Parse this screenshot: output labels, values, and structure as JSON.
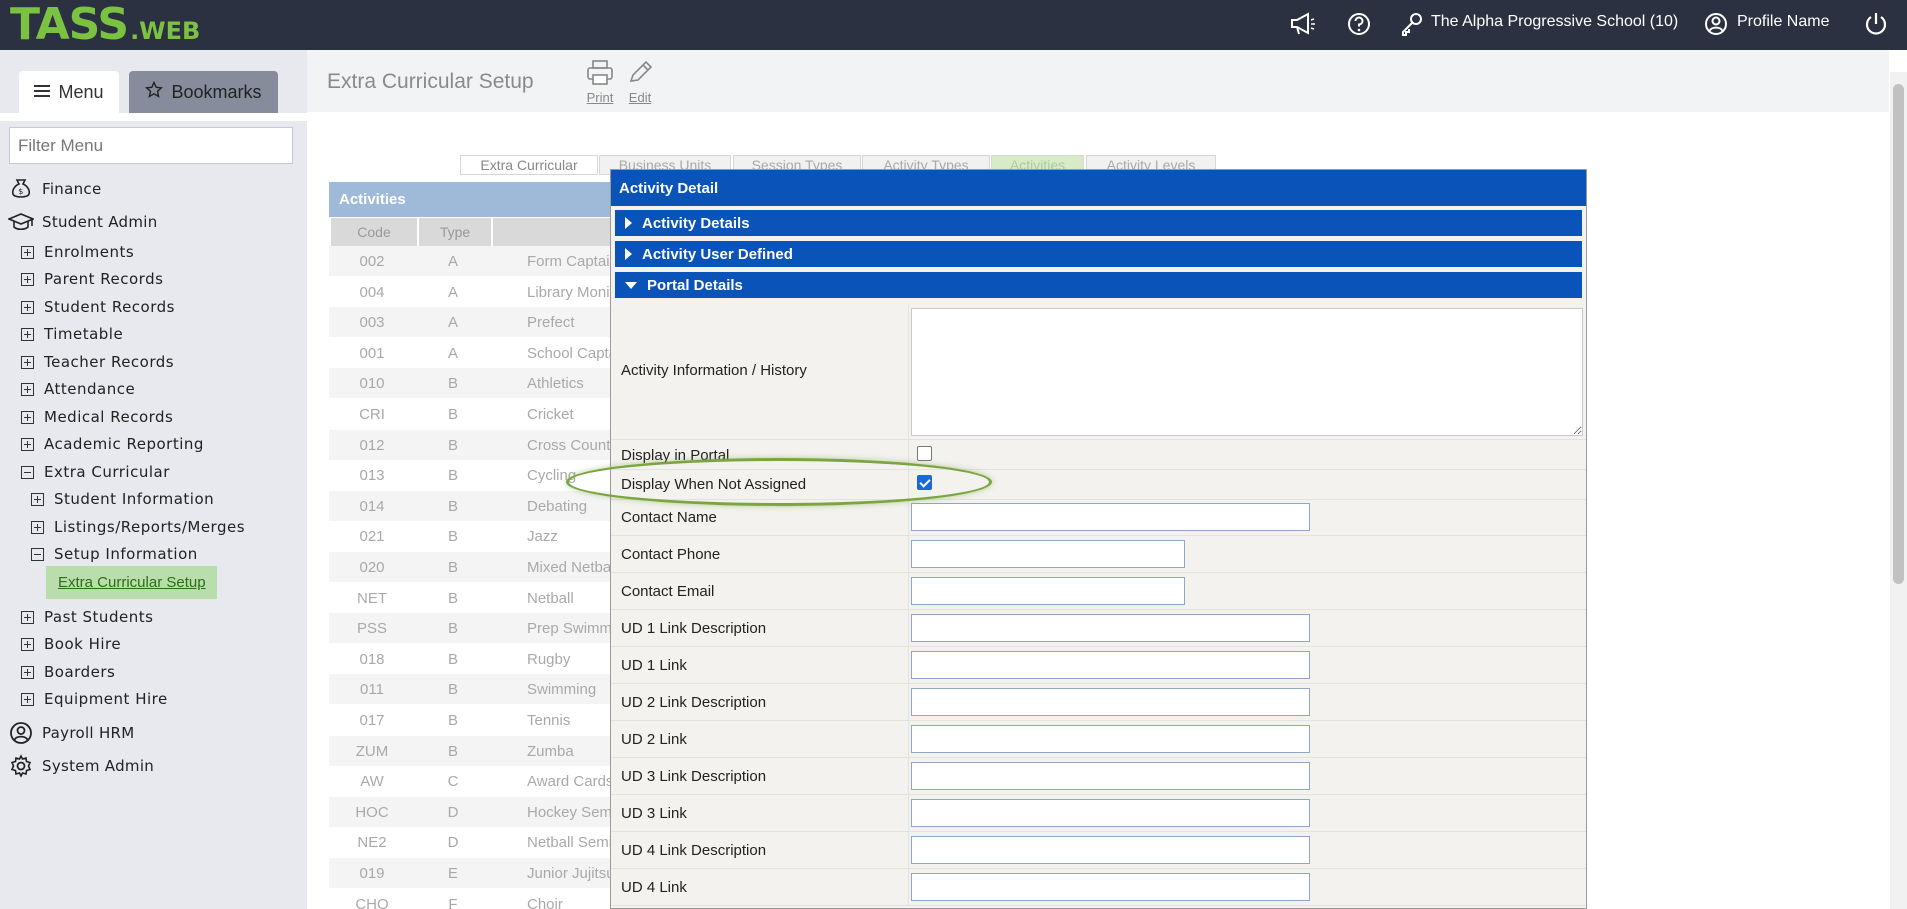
{
  "topbar": {
    "logo_main": "TASS",
    "logo_suffix": ".WEB",
    "school": "The Alpha Progressive School (10)",
    "profile": "Profile Name",
    "icons": [
      "megaphone-icon",
      "help-icon",
      "key-icon",
      "user-circle-icon",
      "power-icon"
    ]
  },
  "sidebar": {
    "menu_label": "Menu",
    "bookmarks_label": "Bookmarks",
    "filter_placeholder": "Filter Menu",
    "sections": {
      "finance": "Finance",
      "student_admin": "Student Admin",
      "payroll": "Payroll HRM",
      "system_admin": "System Admin"
    },
    "items": [
      "Enrolments",
      "Parent Records",
      "Student Records",
      "Timetable",
      "Teacher Records",
      "Attendance",
      "Medical Records",
      "Academic Reporting",
      "Extra Curricular",
      "Student Information",
      "Listings/Reports/Merges",
      "Setup Information",
      "Extra Curricular Setup",
      "Past Students",
      "Book Hire",
      "Boarders",
      "Equipment Hire"
    ]
  },
  "main": {
    "title": "Extra Curricular Setup",
    "print_label": "Print",
    "edit_label": "Edit",
    "tabs": [
      "Extra Curricular",
      "Business Units",
      "Session Types",
      "Activity Types",
      "Activities",
      "Activity Levels"
    ],
    "activities_header": "Activities",
    "columns": [
      "Code",
      "Type"
    ],
    "rows": [
      {
        "code": "002",
        "type": "A",
        "name": "Form Captain"
      },
      {
        "code": "004",
        "type": "A",
        "name": "Library Monitor"
      },
      {
        "code": "003",
        "type": "A",
        "name": "Prefect"
      },
      {
        "code": "001",
        "type": "A",
        "name": "School Captain"
      },
      {
        "code": "010",
        "type": "B",
        "name": "Athletics"
      },
      {
        "code": "CRI",
        "type": "B",
        "name": "Cricket"
      },
      {
        "code": "012",
        "type": "B",
        "name": "Cross Country"
      },
      {
        "code": "013",
        "type": "B",
        "name": "Cycling"
      },
      {
        "code": "014",
        "type": "B",
        "name": "Debating"
      },
      {
        "code": "021",
        "type": "B",
        "name": "Jazz"
      },
      {
        "code": "020",
        "type": "B",
        "name": "Mixed Netball"
      },
      {
        "code": "NET",
        "type": "B",
        "name": "Netball"
      },
      {
        "code": "PSS",
        "type": "B",
        "name": "Prep Swimming"
      },
      {
        "code": "018",
        "type": "B",
        "name": "Rugby"
      },
      {
        "code": "011",
        "type": "B",
        "name": "Swimming"
      },
      {
        "code": "017",
        "type": "B",
        "name": "Tennis"
      },
      {
        "code": "ZUM",
        "type": "B",
        "name": "Zumba"
      },
      {
        "code": "AW",
        "type": "C",
        "name": "Award Cards"
      },
      {
        "code": "HOC",
        "type": "D",
        "name": "Hockey Seminar"
      },
      {
        "code": "NE2",
        "type": "D",
        "name": "Netball Seminar"
      },
      {
        "code": "019",
        "type": "E",
        "name": "Junior Jujitsu"
      },
      {
        "code": "CHO",
        "type": "F",
        "name": "Choir"
      }
    ]
  },
  "modal": {
    "title": "Activity Detail",
    "sections": [
      "Activity Details",
      "Activity User Defined",
      "Portal Details"
    ],
    "fields": {
      "history": "Activity Information / History",
      "display_portal": "Display in Portal",
      "display_not_assigned": "Display When Not Assigned",
      "contact_name": "Contact Name",
      "contact_phone": "Contact Phone",
      "contact_email": "Contact Email",
      "ud1_desc": "UD 1 Link Description",
      "ud1_link": "UD 1 Link",
      "ud2_desc": "UD 2 Link Description",
      "ud2_link": "UD 2 Link",
      "ud3_desc": "UD 3 Link Description",
      "ud3_link": "UD 3 Link",
      "ud4_desc": "UD 4 Link Description",
      "ud4_link": "UD 4 Link"
    },
    "display_portal_checked": false,
    "display_not_assigned_checked": true
  },
  "colors": {
    "topbar": "#2b3140",
    "logo": "#7cc242",
    "modal_header": "#0a53b8",
    "highlight": "#7aa540",
    "active_item_bg": "#b9ddab"
  }
}
